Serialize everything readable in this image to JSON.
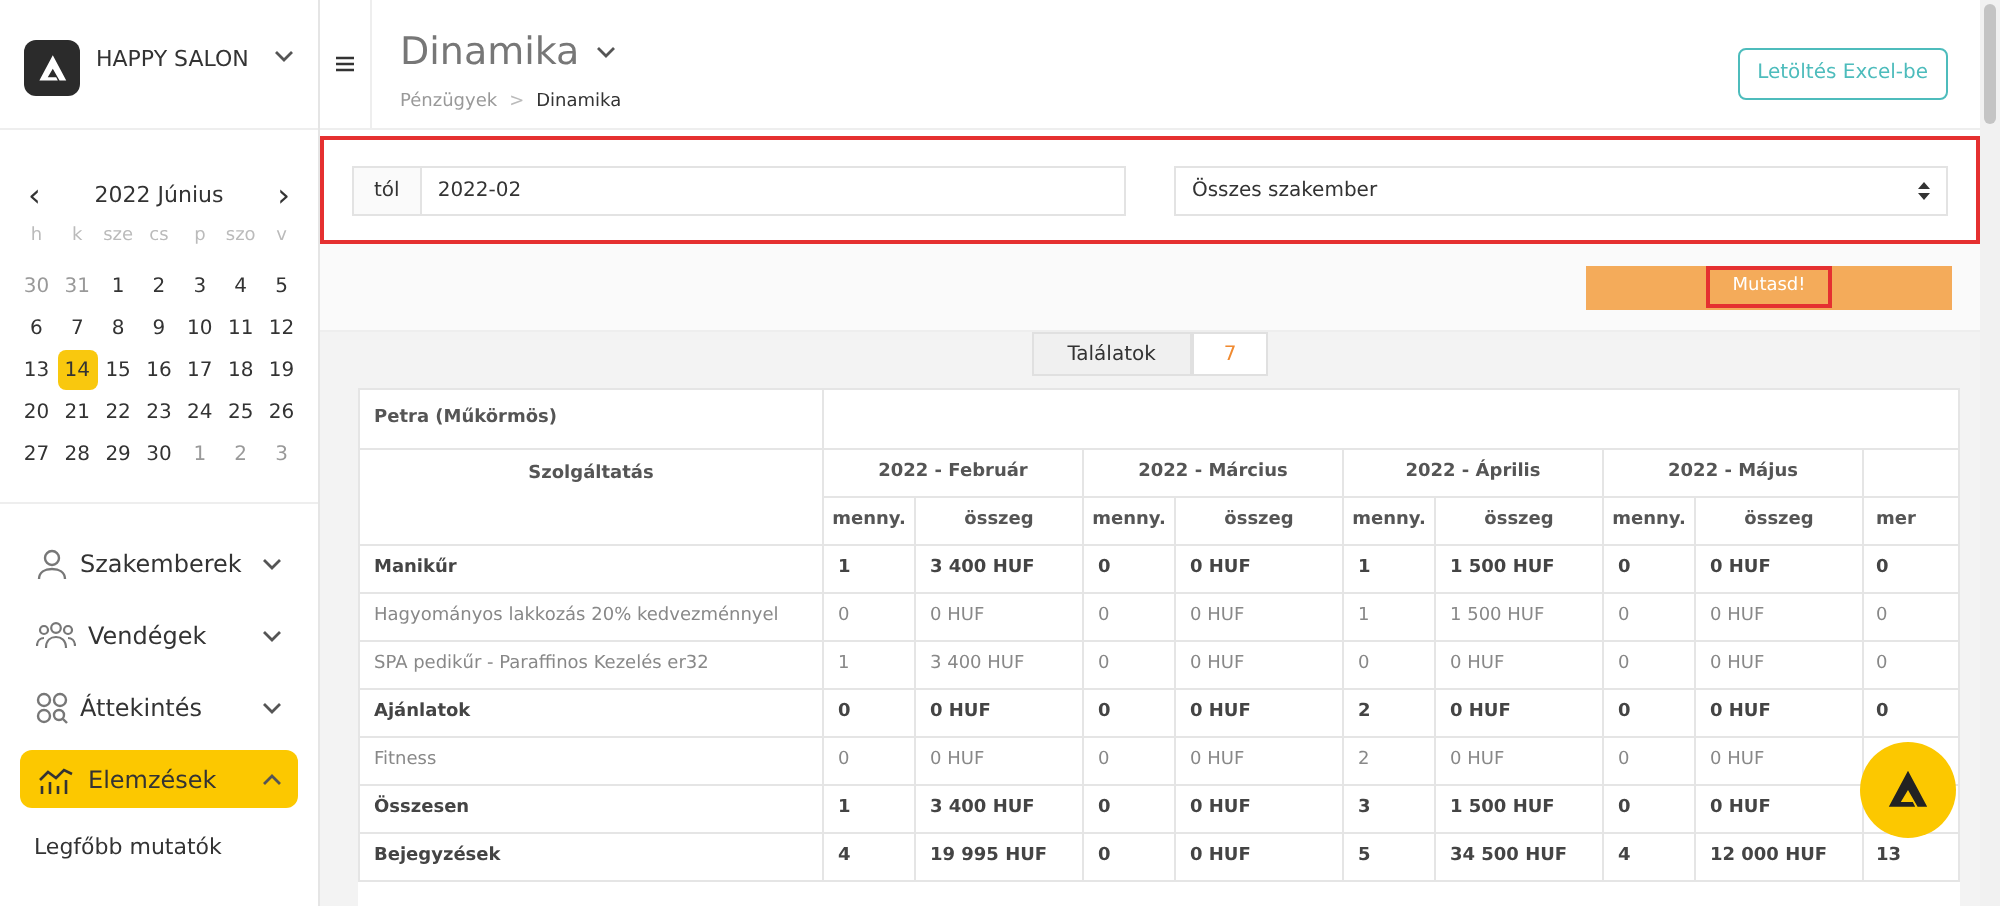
{
  "brand": {
    "name": "HAPPY SALON"
  },
  "calendar": {
    "title": "2022 Június",
    "prev": "‹",
    "next": "›",
    "weekdays": [
      "h",
      "k",
      "sze",
      "cs",
      "p",
      "szo",
      "v"
    ],
    "days": [
      {
        "label": "30",
        "muted": true,
        "selected": false
      },
      {
        "label": "31",
        "muted": true,
        "selected": false
      },
      {
        "label": "1",
        "muted": false,
        "selected": false
      },
      {
        "label": "2",
        "muted": false,
        "selected": false
      },
      {
        "label": "3",
        "muted": false,
        "selected": false
      },
      {
        "label": "4",
        "muted": false,
        "selected": false
      },
      {
        "label": "5",
        "muted": false,
        "selected": false
      },
      {
        "label": "6",
        "muted": false,
        "selected": false
      },
      {
        "label": "7",
        "muted": false,
        "selected": false
      },
      {
        "label": "8",
        "muted": false,
        "selected": false
      },
      {
        "label": "9",
        "muted": false,
        "selected": false
      },
      {
        "label": "10",
        "muted": false,
        "selected": false
      },
      {
        "label": "11",
        "muted": false,
        "selected": false
      },
      {
        "label": "12",
        "muted": false,
        "selected": false
      },
      {
        "label": "13",
        "muted": false,
        "selected": false
      },
      {
        "label": "14",
        "muted": false,
        "selected": true
      },
      {
        "label": "15",
        "muted": false,
        "selected": false
      },
      {
        "label": "16",
        "muted": false,
        "selected": false
      },
      {
        "label": "17",
        "muted": false,
        "selected": false
      },
      {
        "label": "18",
        "muted": false,
        "selected": false
      },
      {
        "label": "19",
        "muted": false,
        "selected": false
      },
      {
        "label": "20",
        "muted": false,
        "selected": false
      },
      {
        "label": "21",
        "muted": false,
        "selected": false
      },
      {
        "label": "22",
        "muted": false,
        "selected": false
      },
      {
        "label": "23",
        "muted": false,
        "selected": false
      },
      {
        "label": "24",
        "muted": false,
        "selected": false
      },
      {
        "label": "25",
        "muted": false,
        "selected": false
      },
      {
        "label": "26",
        "muted": false,
        "selected": false
      },
      {
        "label": "27",
        "muted": false,
        "selected": false
      },
      {
        "label": "28",
        "muted": false,
        "selected": false
      },
      {
        "label": "29",
        "muted": false,
        "selected": false
      },
      {
        "label": "30",
        "muted": false,
        "selected": false
      },
      {
        "label": "1",
        "muted": true,
        "selected": false
      },
      {
        "label": "2",
        "muted": true,
        "selected": false
      },
      {
        "label": "3",
        "muted": true,
        "selected": false
      }
    ]
  },
  "nav": [
    {
      "label": "Szakemberek",
      "kind": "person",
      "expanded": false,
      "selected": false
    },
    {
      "label": "Vendégek",
      "kind": "people",
      "expanded": false,
      "selected": false
    },
    {
      "label": "Áttekintés",
      "kind": "grid",
      "expanded": false,
      "selected": false
    },
    {
      "label": "Elemzések",
      "kind": "chart",
      "expanded": true,
      "selected": true
    }
  ],
  "subnav": [
    "Legfőbb mutatók"
  ],
  "header": {
    "title": "Dinamika",
    "breadcrumb": [
      "Pénzügyek",
      "Dinamika"
    ],
    "breadcrumb_sep": ">",
    "export_button": "Letöltés Excel-be"
  },
  "filters": {
    "highlighted": true,
    "from_label": "tól",
    "from_value": "2022-02",
    "specialist_value": "Összes szakember"
  },
  "show_button": {
    "label": "Mutasd!",
    "highlighted": true
  },
  "results": {
    "label": "Találatok",
    "count": "7"
  },
  "table": {
    "person": "Petra (Műkörmös)",
    "service_header": "Szolgáltatás",
    "months": [
      {
        "title": "2022 - Február",
        "qty": "menny.",
        "amount": "összeg"
      },
      {
        "title": "2022 - Március",
        "qty": "menny.",
        "amount": "összeg"
      },
      {
        "title": "2022 - Április",
        "qty": "menny.",
        "amount": "összeg"
      },
      {
        "title": "2022 - Május",
        "qty": "menny.",
        "amount": "összeg"
      }
    ],
    "cut_sub_header": "mer",
    "rows": [
      {
        "label": "Manikűr",
        "bold": true,
        "cells": [
          "1",
          "3 400 HUF",
          "0",
          "0 HUF",
          "1",
          "1 500 HUF",
          "0",
          "0 HUF"
        ],
        "cut": "0"
      },
      {
        "label": "Hagyományos lakkozás 20% kedvezménnyel",
        "bold": false,
        "cells": [
          "0",
          "0 HUF",
          "0",
          "0 HUF",
          "1",
          "1 500 HUF",
          "0",
          "0 HUF"
        ],
        "cut": "0"
      },
      {
        "label": "SPA pedikűr - Paraffinos Kezelés er32",
        "bold": false,
        "cells": [
          "1",
          "3 400 HUF",
          "0",
          "0 HUF",
          "0",
          "0 HUF",
          "0",
          "0 HUF"
        ],
        "cut": "0"
      },
      {
        "label": "Ajánlatok",
        "bold": true,
        "cells": [
          "0",
          "0 HUF",
          "0",
          "0 HUF",
          "2",
          "0 HUF",
          "0",
          "0 HUF"
        ],
        "cut": "0"
      },
      {
        "label": "Fitness",
        "bold": false,
        "cells": [
          "0",
          "0 HUF",
          "0",
          "0 HUF",
          "2",
          "0 HUF",
          "0",
          "0 HUF"
        ]
      },
      {
        "label": "Összesen",
        "bold": true,
        "cells": [
          "1",
          "3 400 HUF",
          "0",
          "0 HUF",
          "3",
          "1 500 HUF",
          "0",
          "0 HUF"
        ]
      },
      {
        "label": "Bejegyzések",
        "bold": true,
        "cells": [
          "4",
          "19 995 HUF",
          "0",
          "0 HUF",
          "5",
          "34 500 HUF",
          "4",
          "12 000 HUF"
        ],
        "cut": "13"
      }
    ]
  }
}
